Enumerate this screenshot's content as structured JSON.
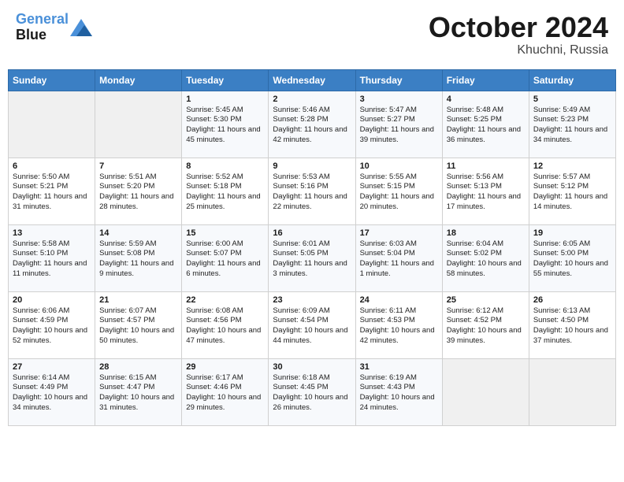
{
  "header": {
    "logo_line1": "General",
    "logo_line2": "Blue",
    "month": "October 2024",
    "location": "Khuchni, Russia"
  },
  "weekdays": [
    "Sunday",
    "Monday",
    "Tuesday",
    "Wednesday",
    "Thursday",
    "Friday",
    "Saturday"
  ],
  "weeks": [
    [
      {
        "day": "",
        "info": ""
      },
      {
        "day": "",
        "info": ""
      },
      {
        "day": "1",
        "info": "Sunrise: 5:45 AM\nSunset: 5:30 PM\nDaylight: 11 hours and 45 minutes."
      },
      {
        "day": "2",
        "info": "Sunrise: 5:46 AM\nSunset: 5:28 PM\nDaylight: 11 hours and 42 minutes."
      },
      {
        "day": "3",
        "info": "Sunrise: 5:47 AM\nSunset: 5:27 PM\nDaylight: 11 hours and 39 minutes."
      },
      {
        "day": "4",
        "info": "Sunrise: 5:48 AM\nSunset: 5:25 PM\nDaylight: 11 hours and 36 minutes."
      },
      {
        "day": "5",
        "info": "Sunrise: 5:49 AM\nSunset: 5:23 PM\nDaylight: 11 hours and 34 minutes."
      }
    ],
    [
      {
        "day": "6",
        "info": "Sunrise: 5:50 AM\nSunset: 5:21 PM\nDaylight: 11 hours and 31 minutes."
      },
      {
        "day": "7",
        "info": "Sunrise: 5:51 AM\nSunset: 5:20 PM\nDaylight: 11 hours and 28 minutes."
      },
      {
        "day": "8",
        "info": "Sunrise: 5:52 AM\nSunset: 5:18 PM\nDaylight: 11 hours and 25 minutes."
      },
      {
        "day": "9",
        "info": "Sunrise: 5:53 AM\nSunset: 5:16 PM\nDaylight: 11 hours and 22 minutes."
      },
      {
        "day": "10",
        "info": "Sunrise: 5:55 AM\nSunset: 5:15 PM\nDaylight: 11 hours and 20 minutes."
      },
      {
        "day": "11",
        "info": "Sunrise: 5:56 AM\nSunset: 5:13 PM\nDaylight: 11 hours and 17 minutes."
      },
      {
        "day": "12",
        "info": "Sunrise: 5:57 AM\nSunset: 5:12 PM\nDaylight: 11 hours and 14 minutes."
      }
    ],
    [
      {
        "day": "13",
        "info": "Sunrise: 5:58 AM\nSunset: 5:10 PM\nDaylight: 11 hours and 11 minutes."
      },
      {
        "day": "14",
        "info": "Sunrise: 5:59 AM\nSunset: 5:08 PM\nDaylight: 11 hours and 9 minutes."
      },
      {
        "day": "15",
        "info": "Sunrise: 6:00 AM\nSunset: 5:07 PM\nDaylight: 11 hours and 6 minutes."
      },
      {
        "day": "16",
        "info": "Sunrise: 6:01 AM\nSunset: 5:05 PM\nDaylight: 11 hours and 3 minutes."
      },
      {
        "day": "17",
        "info": "Sunrise: 6:03 AM\nSunset: 5:04 PM\nDaylight: 11 hours and 1 minute."
      },
      {
        "day": "18",
        "info": "Sunrise: 6:04 AM\nSunset: 5:02 PM\nDaylight: 10 hours and 58 minutes."
      },
      {
        "day": "19",
        "info": "Sunrise: 6:05 AM\nSunset: 5:00 PM\nDaylight: 10 hours and 55 minutes."
      }
    ],
    [
      {
        "day": "20",
        "info": "Sunrise: 6:06 AM\nSunset: 4:59 PM\nDaylight: 10 hours and 52 minutes."
      },
      {
        "day": "21",
        "info": "Sunrise: 6:07 AM\nSunset: 4:57 PM\nDaylight: 10 hours and 50 minutes."
      },
      {
        "day": "22",
        "info": "Sunrise: 6:08 AM\nSunset: 4:56 PM\nDaylight: 10 hours and 47 minutes."
      },
      {
        "day": "23",
        "info": "Sunrise: 6:09 AM\nSunset: 4:54 PM\nDaylight: 10 hours and 44 minutes."
      },
      {
        "day": "24",
        "info": "Sunrise: 6:11 AM\nSunset: 4:53 PM\nDaylight: 10 hours and 42 minutes."
      },
      {
        "day": "25",
        "info": "Sunrise: 6:12 AM\nSunset: 4:52 PM\nDaylight: 10 hours and 39 minutes."
      },
      {
        "day": "26",
        "info": "Sunrise: 6:13 AM\nSunset: 4:50 PM\nDaylight: 10 hours and 37 minutes."
      }
    ],
    [
      {
        "day": "27",
        "info": "Sunrise: 6:14 AM\nSunset: 4:49 PM\nDaylight: 10 hours and 34 minutes."
      },
      {
        "day": "28",
        "info": "Sunrise: 6:15 AM\nSunset: 4:47 PM\nDaylight: 10 hours and 31 minutes."
      },
      {
        "day": "29",
        "info": "Sunrise: 6:17 AM\nSunset: 4:46 PM\nDaylight: 10 hours and 29 minutes."
      },
      {
        "day": "30",
        "info": "Sunrise: 6:18 AM\nSunset: 4:45 PM\nDaylight: 10 hours and 26 minutes."
      },
      {
        "day": "31",
        "info": "Sunrise: 6:19 AM\nSunset: 4:43 PM\nDaylight: 10 hours and 24 minutes."
      },
      {
        "day": "",
        "info": ""
      },
      {
        "day": "",
        "info": ""
      }
    ]
  ]
}
